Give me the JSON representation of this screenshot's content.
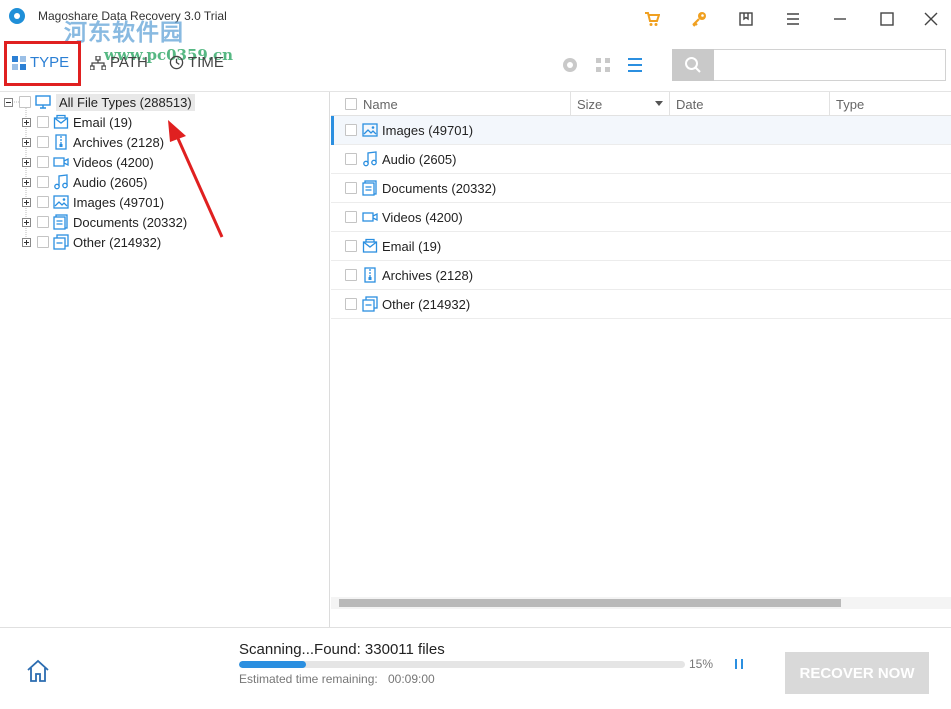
{
  "window": {
    "title": "Magoshare Data Recovery 3.0 Trial",
    "watermark": "河东软件园",
    "watermark_url": "www.pc0359.cn"
  },
  "colors": {
    "accent": "#2b8fe0",
    "cart": "#f0a020",
    "key": "#f0a020",
    "highlight": "#e02020"
  },
  "toolbar": {
    "tabs": [
      {
        "label": "TYPE",
        "icon": "type-grid-icon"
      },
      {
        "label": "PATH",
        "icon": "path-tree-icon"
      },
      {
        "label": "TIME",
        "icon": "clock-icon"
      }
    ],
    "search_placeholder": ""
  },
  "tree": {
    "root": {
      "label": "All File Types (288513)",
      "icon": "monitor-icon"
    },
    "items": [
      {
        "label": "Email (19)",
        "icon": "email-icon"
      },
      {
        "label": "Archives (2128)",
        "icon": "archive-icon"
      },
      {
        "label": "Videos (4200)",
        "icon": "video-icon"
      },
      {
        "label": "Audio (2605)",
        "icon": "audio-icon"
      },
      {
        "label": "Images (49701)",
        "icon": "image-icon"
      },
      {
        "label": "Documents (20332)",
        "icon": "document-icon"
      },
      {
        "label": "Other (214932)",
        "icon": "other-icon"
      }
    ]
  },
  "list": {
    "columns": [
      "Name",
      "Size",
      "Date",
      "Type"
    ],
    "rows": [
      {
        "name": "Images (49701)",
        "icon": "image-icon"
      },
      {
        "name": "Audio (2605)",
        "icon": "audio-icon"
      },
      {
        "name": "Documents (20332)",
        "icon": "document-icon"
      },
      {
        "name": "Videos (4200)",
        "icon": "video-icon"
      },
      {
        "name": "Email (19)",
        "icon": "email-icon"
      },
      {
        "name": "Archives (2128)",
        "icon": "archive-icon"
      },
      {
        "name": "Other (214932)",
        "icon": "other-icon"
      }
    ]
  },
  "status": {
    "scanning": "Scanning...Found: 330011 files",
    "progress_percent": 15,
    "progress_label": "15%",
    "eta_label": "Estimated time remaining:",
    "eta_value": "00:09:00",
    "recover_label": "RECOVER NOW"
  }
}
